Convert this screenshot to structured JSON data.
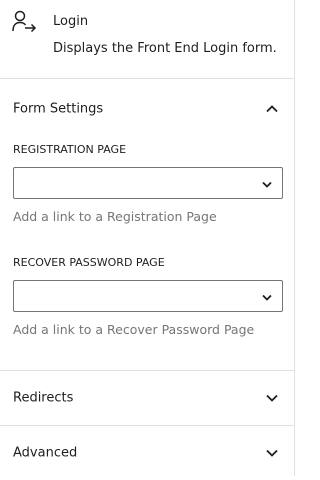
{
  "block": {
    "icon": "user-login-icon",
    "title": "Login",
    "description": "Displays the Front End Login form."
  },
  "panels": {
    "form_settings": {
      "title": "Form Settings",
      "expanded": true,
      "chevron_icon": "chevron-up-icon",
      "fields": [
        {
          "label": "REGISTRATION PAGE",
          "value": "",
          "help": "Add a link to a Registration Page"
        },
        {
          "label": "RECOVER PASSWORD PAGE",
          "value": "",
          "help": "Add a link to a Recover Password Page"
        }
      ]
    },
    "redirects": {
      "title": "Redirects",
      "expanded": false,
      "chevron_icon": "chevron-down-icon"
    },
    "advanced": {
      "title": "Advanced",
      "expanded": false,
      "chevron_icon": "chevron-down-icon"
    }
  },
  "colors": {
    "text": "#1e1e1e",
    "help_text": "#757575",
    "divider": "#e0e0e0",
    "input_border": "#757575"
  }
}
